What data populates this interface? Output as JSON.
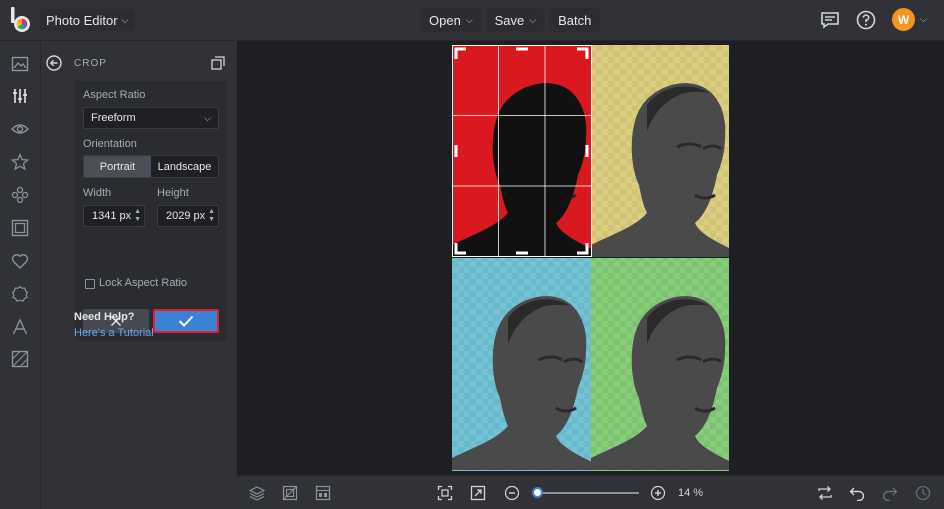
{
  "header": {
    "app_menu_label": "Photo Editor",
    "menu": [
      {
        "label": "Open"
      },
      {
        "label": "Save"
      },
      {
        "label": "Batch"
      }
    ],
    "avatar_initial": "W"
  },
  "panel": {
    "title": "CROP",
    "aspect_ratio_label": "Aspect Ratio",
    "aspect_ratio_value": "Freeform",
    "orientation_label": "Orientation",
    "orientation_options": [
      "Portrait",
      "Landscape"
    ],
    "orientation_selected": "Portrait",
    "width_label": "Width",
    "width_value": "1341",
    "height_label": "Height",
    "height_value": "2029",
    "unit": "px",
    "lock_label": "Lock Aspect Ratio",
    "lock_checked": false,
    "help_title": "Need Help?",
    "help_link": "Here's a Tutorial"
  },
  "canvas": {
    "quadrant_colors": [
      "#d9191f",
      "#ffea73",
      "#5fd8f5",
      "#7de86b"
    ],
    "crop_grid": "3x3"
  },
  "footer": {
    "zoom": "14 %",
    "zoom_level": 0.14
  },
  "colors": {
    "accent": "#3b82d6",
    "highlight": "#e01f26",
    "avatar": "#f7941d"
  }
}
